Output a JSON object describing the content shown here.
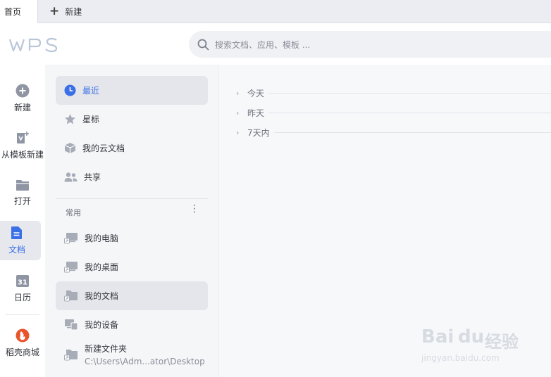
{
  "tabs": {
    "home": "首页",
    "new_tab": "新建"
  },
  "search": {
    "placeholder": "搜索文档、应用、模板 ..."
  },
  "logo": {
    "text": "WPS"
  },
  "rail": {
    "items": [
      {
        "label": "新建",
        "icon": "plus-circle-icon"
      },
      {
        "label": "从模板新建",
        "icon": "template-icon"
      },
      {
        "label": "打开",
        "icon": "folder-open-icon"
      },
      {
        "label": "文档",
        "icon": "document-icon"
      },
      {
        "label": "日历",
        "icon": "calendar-icon",
        "icon_text": "31"
      },
      {
        "label": "稻壳商城",
        "icon": "docer-store-icon"
      }
    ]
  },
  "nav": {
    "items": [
      {
        "label": "最近",
        "icon": "clock-icon"
      },
      {
        "label": "星标",
        "icon": "star-icon"
      },
      {
        "label": "我的云文档",
        "icon": "cloud-box-icon"
      },
      {
        "label": "共享",
        "icon": "people-icon"
      }
    ],
    "section_label": "常用",
    "more": "⋮",
    "common": [
      {
        "label": "我的电脑",
        "icon": "computer-icon"
      },
      {
        "label": "我的桌面",
        "icon": "desktop-icon"
      },
      {
        "label": "我的文档",
        "icon": "folder-icon"
      },
      {
        "label": "我的设备",
        "icon": "devices-icon"
      },
      {
        "label": "新建文件夹",
        "sub": "C:\\Users\\Adm...ator\\Desktop",
        "icon": "folder-icon"
      }
    ]
  },
  "main": {
    "groups": [
      {
        "label": "今天"
      },
      {
        "label": "昨天"
      },
      {
        "label": "7天内"
      }
    ]
  },
  "watermark": {
    "brand": "Bai",
    "brand2": "du",
    "cn": "经验",
    "url": "jingyan.baidu.com"
  },
  "colors": {
    "accent": "#3b6fe6",
    "docer": "#e8552d",
    "rail_icon": "#8f95a3",
    "logo": "#b9c6d8"
  }
}
